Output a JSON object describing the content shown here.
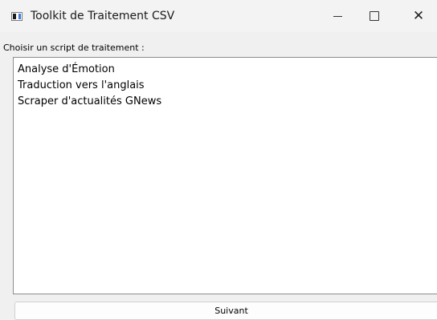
{
  "window": {
    "title": "Toolkit de Traitement CSV",
    "controls": {
      "minimize_icon": "minimize-icon",
      "maximize_icon": "maximize-icon",
      "close_icon": "close-icon",
      "close_glyph": "✕"
    }
  },
  "main": {
    "prompt": "Choisir un script de traitement :",
    "scripts": [
      "Analyse d'Émotion",
      "Traduction vers l'anglais",
      "Scraper d'actualités GNews"
    ],
    "next_label": "Suivant"
  }
}
